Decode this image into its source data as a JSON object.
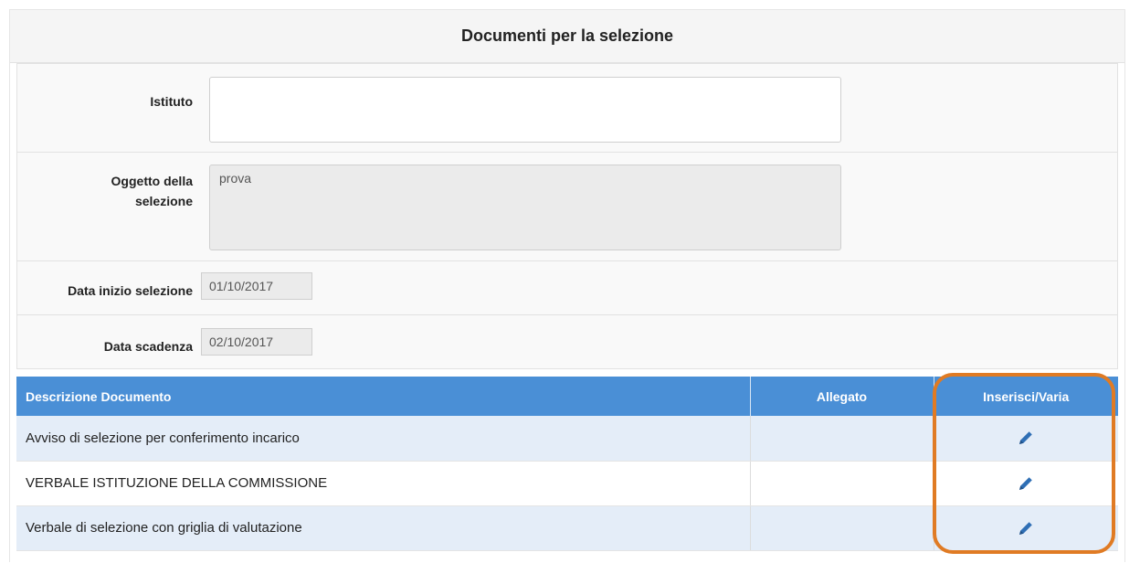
{
  "panel": {
    "title": "Documenti per la selezione"
  },
  "form": {
    "istituto": {
      "label": "Istituto",
      "value": ""
    },
    "oggetto": {
      "label_line1": "Oggetto della",
      "label_line2": "selezione",
      "value": "prova"
    },
    "data_inizio": {
      "label": "Data inizio selezione",
      "value": "01/10/2017"
    },
    "data_scadenza": {
      "label": "Data scadenza",
      "value": "02/10/2017"
    }
  },
  "table": {
    "headers": {
      "descrizione": "Descrizione Documento",
      "allegato": "Allegato",
      "azione": "Inserisci/Varia"
    },
    "rows": [
      {
        "descrizione": "Avviso di selezione per conferimento incarico",
        "allegato": "",
        "icon": "pencil-icon"
      },
      {
        "descrizione": "VERBALE ISTITUZIONE DELLA COMMISSIONE",
        "allegato": "",
        "icon": "pencil-icon"
      },
      {
        "descrizione": "Verbale di selezione con griglia di valutazione",
        "allegato": "",
        "icon": "pencil-icon"
      }
    ]
  },
  "colors": {
    "table_header": "#4a8fd6",
    "row_alt": "#e4edf8",
    "pencil": "#2f6fb5",
    "highlight": "#e07b24"
  }
}
